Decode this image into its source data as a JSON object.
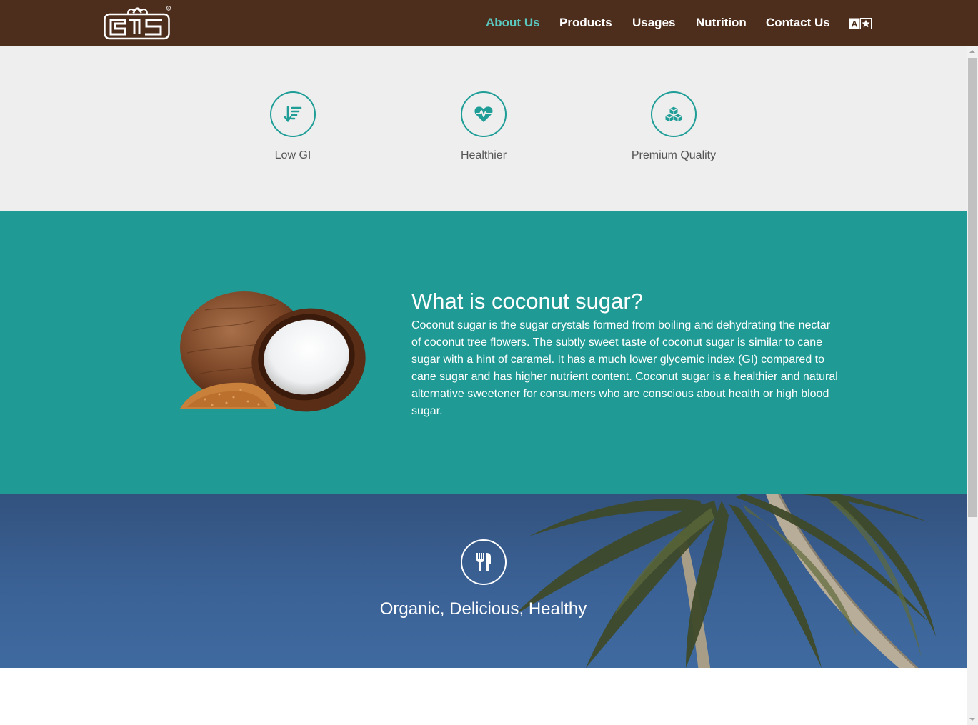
{
  "nav": {
    "items": [
      {
        "label": "About Us",
        "active": true
      },
      {
        "label": "Products",
        "active": false
      },
      {
        "label": "Usages",
        "active": false
      },
      {
        "label": "Nutrition",
        "active": false
      },
      {
        "label": "Contact Us",
        "active": false
      }
    ],
    "language_icon": "translate-icon",
    "logo_icon": "brand-logo-icon"
  },
  "features": [
    {
      "label": "Low GI",
      "icon": "sort-descending-icon"
    },
    {
      "label": "Healthier",
      "icon": "heartbeat-icon"
    },
    {
      "label": "Premium Quality",
      "icon": "sugar-cubes-icon"
    }
  ],
  "about": {
    "title": "What is coconut sugar?",
    "body": "Coconut sugar is the sugar crystals formed from boiling and dehydrating the nectar of coconut tree flowers. The subtly sweet taste of coconut sugar is similar to cane sugar with a hint of caramel. It has a much lower glycemic index (GI) compared to cane sugar and has higher nutrient content. Coconut sugar is a healthier and natural alternative sweetener for consumers who are conscious about health or high blood sugar."
  },
  "banner": {
    "tagline": "Organic, Delicious, Healthy",
    "icon": "utensils-icon"
  },
  "colors": {
    "navbar": "#4d2d1b",
    "accent": "#1f9a95",
    "active_link": "#5bc8c0",
    "features_bg": "#eeeeee"
  }
}
